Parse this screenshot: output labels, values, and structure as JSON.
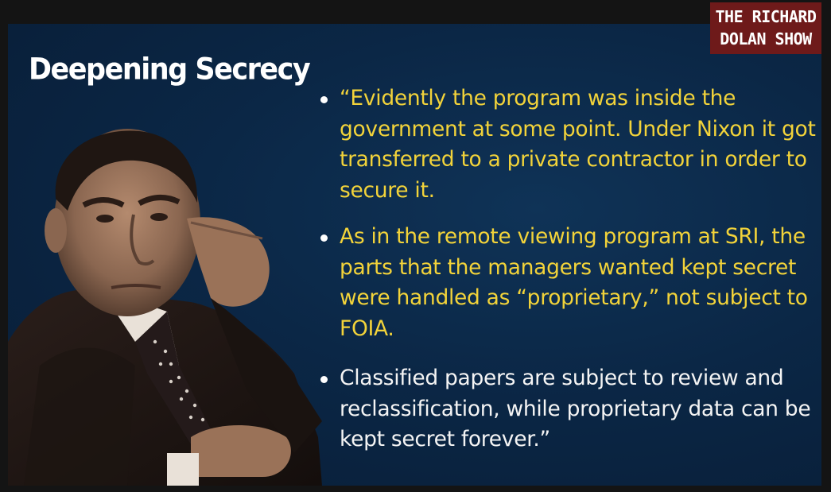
{
  "slide": {
    "title": "Deepening Secrecy",
    "bullets": [
      {
        "text": "“Evidently the program was inside the government at some point. Under Nixon it got transferred to a private contractor in order to secure it.",
        "color": "#f2d33a"
      },
      {
        "text": "As in the remote viewing program at SRI, the parts that the managers wanted kept secret were handled as “proprietary,” not subject to FOIA.",
        "color": "#f2d33a"
      },
      {
        "text": "Classified papers are subject to review and reclassification, while proprietary data can be kept secret forever.”",
        "color": "#f4f4f4"
      }
    ]
  },
  "logo": {
    "line1": "THE RICHARD",
    "line2": "DOLAN SHOW"
  },
  "colors": {
    "slide_background": "#0b2746",
    "title": "#ffffff",
    "highlight_text": "#f2d33a",
    "logo_background": "#6e1a1a"
  },
  "icons": [
    "bullet-dot-icon"
  ]
}
